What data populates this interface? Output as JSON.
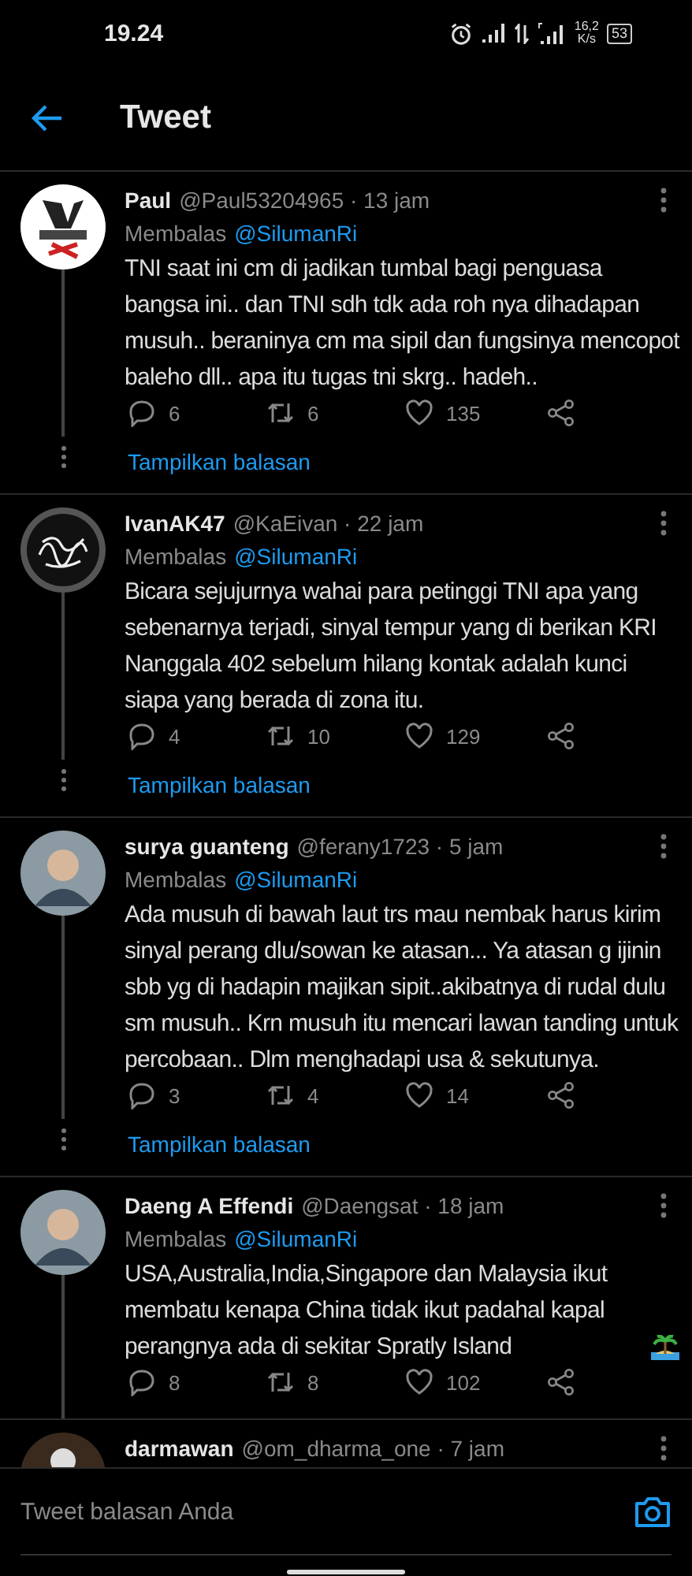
{
  "status_bar": {
    "time": "19.24",
    "speed_value": "16,2",
    "speed_unit": "K/s",
    "battery": "53"
  },
  "header": {
    "title": "Tweet"
  },
  "tweets": [
    {
      "kind": "logo",
      "name": "Paul",
      "meta": "@Paul53204965 · 13 jam",
      "reply_label": "Membalas",
      "reply_to": "@SilumanRi",
      "text": "TNI saat ini cm di jadikan tumbal bagi penguasa bangsa ini.. dan TNI sdh tdk ada roh nya dihadapan musuh.. beraninya cm ma sipil dan fungsinya mencopot baleho dll.. apa itu tugas tni skrg.. hadeh..",
      "replies": "6",
      "retweets": "6",
      "likes": "135",
      "show_replies": "Tampilkan balasan"
    },
    {
      "kind": "calligraphy",
      "name": "IvanAK47",
      "meta": "@KaEivan · 22 jam",
      "reply_label": "Membalas",
      "reply_to": "@SilumanRi",
      "text": "Bicara sejujurnya wahai para petinggi TNI apa yang sebenarnya terjadi, sinyal tempur yang di berikan KRI Nanggala 402 sebelum hilang kontak adalah kunci siapa yang berada di zona itu.",
      "replies": "4",
      "retweets": "10",
      "likes": "129",
      "show_replies": "Tampilkan balasan"
    },
    {
      "kind": "photo",
      "name": "surya guanteng",
      "meta": "@ferany1723 · 5 jam",
      "reply_label": "Membalas",
      "reply_to": "@SilumanRi",
      "text": "Ada musuh di bawah laut trs mau nembak harus kirim sinyal perang dlu/sowan ke atasan... Ya atasan g ijinin sbb yg di hadapin majikan sipit..akibatnya di rudal dulu sm musuh.. Krn musuh itu mencari lawan tanding untuk percobaan.. Dlm menghadapi usa & sekutunya.",
      "replies": "3",
      "retweets": "4",
      "likes": "14",
      "show_replies": "Tampilkan balasan"
    },
    {
      "kind": "photo",
      "name": "Daeng A Effendi",
      "meta": "@Daengsat · 18 jam",
      "reply_label": "Membalas",
      "reply_to": "@SilumanRi",
      "text": "USA,Australia,India,Singapore dan Malaysia ikut membatu kenapa China tidak ikut padahal kapal perangnya ada di sekitar Spratly Island",
      "replies": "8",
      "retweets": "8",
      "likes": "102"
    },
    {
      "kind": "dark",
      "name": "darmawan",
      "meta": "@om_dharma_one · 7 jam"
    }
  ],
  "compose": {
    "placeholder": "Tweet balasan Anda"
  }
}
